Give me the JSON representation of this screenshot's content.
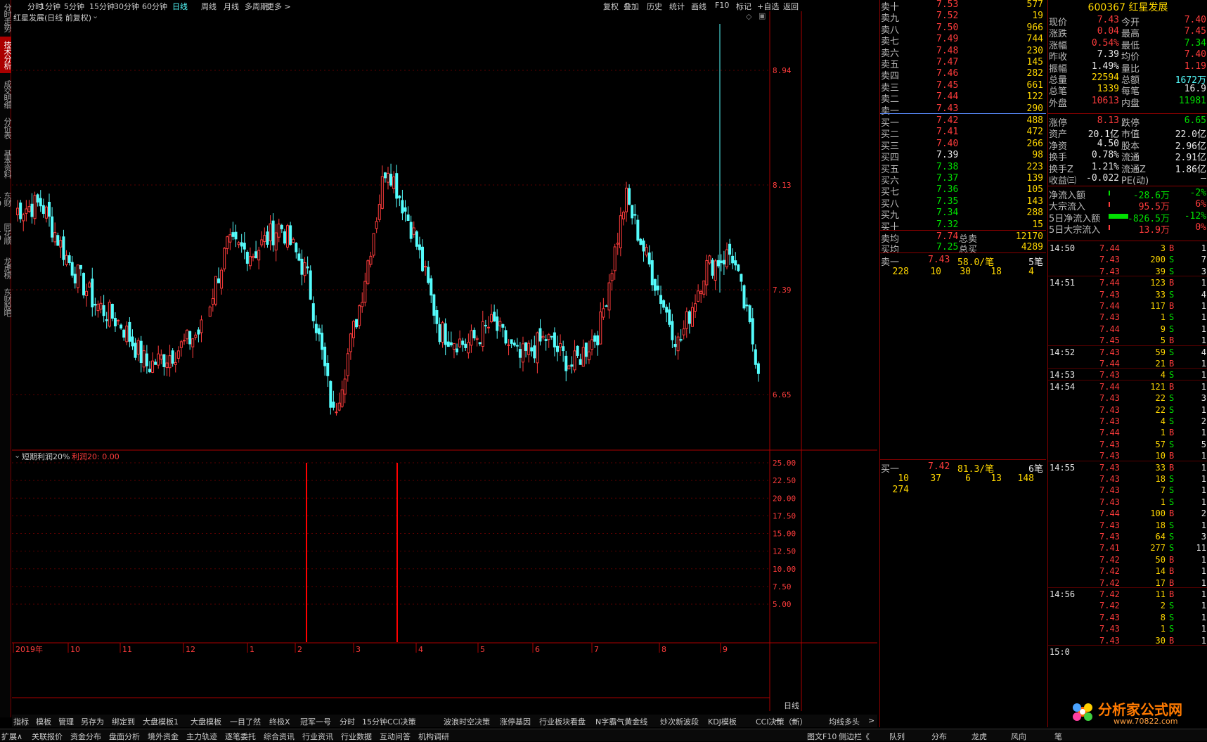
{
  "left_tabs": [
    "分时走势",
    "技术分析",
    "成交明细",
    "分价表",
    "基本资料",
    "东财10",
    "同花顺10",
    "龙虎榜",
    "东财股吧"
  ],
  "top_toolbar": {
    "periods": [
      "分时",
      "1分钟",
      "5分钟",
      "15分钟",
      "30分钟",
      "60分钟",
      "日线",
      "周线",
      "月线",
      "多周期",
      "更多 >"
    ],
    "active": "日线",
    "tools": [
      "复权",
      "叠加",
      "历史",
      "统计",
      "画线",
      "F10",
      "标记",
      "+自选",
      "返回"
    ]
  },
  "chart": {
    "title": "红星发展(日线 前复权)",
    "price_ticks": [
      "8.94",
      "8.13",
      "7.39",
      "6.65"
    ],
    "indicator_name": "短期利润20%",
    "indicator_value": "利润20: 0.00",
    "indicator_ticks": [
      "25.00",
      "22.50",
      "20.00",
      "17.50",
      "15.00",
      "12.50",
      "10.00",
      "7.50",
      "5.00"
    ],
    "date_labels": [
      "2019年",
      "10",
      "11",
      "12",
      "1",
      "2",
      "3",
      "4",
      "5",
      "6",
      "7",
      "8",
      "9"
    ],
    "period_label": "日线",
    "colors": {
      "up": "#ff3c3c",
      "down": "#54fcfc",
      "signal": "#ff0000"
    }
  },
  "chart_data": {
    "type": "candlestick",
    "title": "红星发展(日线 前复权)",
    "y_ticks": [
      8.94,
      8.13,
      7.39,
      6.65
    ],
    "x_labels": [
      "2019年",
      "10",
      "11",
      "12",
      "1",
      "2",
      "3",
      "4",
      "5",
      "6",
      "7",
      "8",
      "9"
    ],
    "indicator": {
      "name": "短期利润20%",
      "ticks": [
        25,
        22.5,
        20,
        17.5,
        15,
        12.5,
        10,
        7.5,
        5
      ],
      "signals": [
        {
          "month": "2",
          "value": 25
        },
        {
          "month": "3",
          "value": 25
        }
      ]
    },
    "approx_close_path": [
      7.95,
      8.0,
      7.6,
      7.3,
      7.15,
      6.85,
      6.95,
      7.1,
      7.7,
      7.65,
      7.85,
      7.5,
      6.5,
      7.3,
      8.3,
      7.8,
      7.1,
      7.0,
      7.15,
      6.9,
      7.05,
      6.85,
      7.1,
      8.05,
      7.5,
      7.0,
      7.55,
      7.65,
      6.85
    ]
  },
  "bottom_tabs": [
    "指标",
    "模板",
    "管理",
    "另存为",
    "绑定到",
    "大盘模板1",
    "大盘模板",
    "一目了然",
    "终极X",
    "冠军一号",
    "分时",
    "15分钟CCI决策",
    "波浪时空决策",
    "涨停基因",
    "行业板块看盘",
    "N字霸气黄金线",
    "炒次新波段",
    "KDJ模板",
    "CCI决策（新）",
    "均线多头",
    ">"
  ],
  "status_bar": {
    "items": [
      "扩展∧",
      "关联报价",
      "资金分布",
      "盘面分析",
      "境外资金",
      "主力轨迹",
      "逐笔委托",
      "综合资讯",
      "行业资讯",
      "行业数据",
      "互动问答",
      "机构调研"
    ],
    "right_items": [
      "图文F10",
      "侧边栏《",
      "队列",
      "分布",
      "龙虎",
      "风向",
      "笔"
    ]
  },
  "order_book": {
    "asks": [
      [
        "卖十",
        "7.53",
        "577"
      ],
      [
        "卖九",
        "7.52",
        "19"
      ],
      [
        "卖八",
        "7.50",
        "966"
      ],
      [
        "卖七",
        "7.49",
        "744"
      ],
      [
        "卖六",
        "7.48",
        "230"
      ],
      [
        "卖五",
        "7.47",
        "145"
      ],
      [
        "卖四",
        "7.46",
        "282"
      ],
      [
        "卖三",
        "7.45",
        "661"
      ],
      [
        "卖二",
        "7.44",
        "122"
      ],
      [
        "卖一",
        "7.43",
        "290"
      ]
    ],
    "bids": [
      [
        "买一",
        "7.42",
        "488"
      ],
      [
        "买二",
        "7.41",
        "472"
      ],
      [
        "买三",
        "7.40",
        "266"
      ],
      [
        "买四",
        "7.39",
        "98"
      ],
      [
        "买五",
        "7.38",
        "223"
      ],
      [
        "买六",
        "7.37",
        "139"
      ],
      [
        "买七",
        "7.36",
        "105"
      ],
      [
        "买八",
        "7.35",
        "143"
      ],
      [
        "买九",
        "7.34",
        "288"
      ],
      [
        "买十",
        "7.32",
        "15"
      ]
    ],
    "avg": [
      [
        "卖均",
        "7.74",
        "总卖",
        "12170"
      ],
      [
        "买均",
        "7.25",
        "总买",
        "4289"
      ]
    ],
    "ask_queue": {
      "label": "卖一",
      "price": "7.43",
      "avg": "58.0/笔",
      "count": "5笔",
      "orders": [
        "228",
        "10",
        "30",
        "18",
        "4"
      ]
    },
    "bid_queue": {
      "label": "买一",
      "price": "7.42",
      "avg": "81.3/笔",
      "count": "6笔",
      "orders": [
        "10",
        "37",
        "6",
        "13",
        "148",
        "274"
      ]
    }
  },
  "quote": {
    "code_name": "600367 红星发展",
    "rows": [
      [
        "现价",
        "7.43",
        "今开",
        "7.40"
      ],
      [
        "涨跌",
        "0.04",
        "最高",
        "7.45"
      ],
      [
        "涨幅",
        "0.54%",
        "最低",
        "7.34"
      ],
      [
        "昨收",
        "7.39",
        "均价",
        "7.40"
      ],
      [
        "振幅",
        "1.49%",
        "量比",
        "1.19"
      ],
      [
        "总量",
        "22594",
        "总额",
        "1672万"
      ],
      [
        "总笔",
        "1339",
        "每笔",
        "16.9"
      ],
      [
        "外盘",
        "10613",
        "内盘",
        "11981"
      ]
    ],
    "rows2": [
      [
        "涨停",
        "8.13",
        "跌停",
        "6.65"
      ],
      [
        "资产",
        "20.1亿",
        "市值",
        "22.0亿"
      ],
      [
        "净资",
        "4.50",
        "股本",
        "2.96亿"
      ],
      [
        "换手",
        "0.78%",
        "流通",
        "2.91亿"
      ],
      [
        "换手Z",
        "1.21%",
        "流通Z",
        "1.86亿"
      ],
      [
        "收益㈢",
        "-0.022",
        "PE(动)",
        "–"
      ]
    ],
    "flows": [
      [
        "净流入额",
        "-28.6万",
        "-2%"
      ],
      [
        "大宗流入",
        "95.5万",
        "6%"
      ],
      [
        "5日净流入额",
        "-826.5万",
        "-12%"
      ],
      [
        "5日大宗流入",
        "13.9万",
        "0%"
      ]
    ]
  },
  "trades": [
    [
      "14:50",
      "7.44",
      "3",
      "B",
      "1"
    ],
    [
      "",
      "7.43",
      "200",
      "S",
      "7"
    ],
    [
      "",
      "7.43",
      "39",
      "S",
      "3"
    ],
    [
      "14:51",
      "7.44",
      "123",
      "B",
      "1"
    ],
    [
      "",
      "7.43",
      "33",
      "S",
      "4"
    ],
    [
      "",
      "7.44",
      "117",
      "B",
      "1"
    ],
    [
      "",
      "7.43",
      "1",
      "S",
      "1"
    ],
    [
      "",
      "7.44",
      "9",
      "S",
      "1"
    ],
    [
      "",
      "7.45",
      "5",
      "B",
      "1"
    ],
    [
      "14:52",
      "7.43",
      "59",
      "S",
      "4"
    ],
    [
      "",
      "7.44",
      "21",
      "B",
      "1"
    ],
    [
      "14:53",
      "7.43",
      "4",
      "S",
      "1"
    ],
    [
      "14:54",
      "7.44",
      "121",
      "B",
      "1"
    ],
    [
      "",
      "7.43",
      "22",
      "S",
      "3"
    ],
    [
      "",
      "7.43",
      "22",
      "S",
      "1"
    ],
    [
      "",
      "7.43",
      "4",
      "S",
      "2"
    ],
    [
      "",
      "7.44",
      "1",
      "B",
      "1"
    ],
    [
      "",
      "7.43",
      "57",
      "S",
      "5"
    ],
    [
      "",
      "7.43",
      "10",
      "B",
      "1"
    ],
    [
      "14:55",
      "7.43",
      "33",
      "B",
      "1"
    ],
    [
      "",
      "7.43",
      "18",
      "S",
      "1"
    ],
    [
      "",
      "7.43",
      "7",
      "S",
      "1"
    ],
    [
      "",
      "7.43",
      "1",
      "S",
      "1"
    ],
    [
      "",
      "7.44",
      "100",
      "B",
      "2"
    ],
    [
      "",
      "7.43",
      "18",
      "S",
      "1"
    ],
    [
      "",
      "7.43",
      "64",
      "S",
      "3"
    ],
    [
      "",
      "7.41",
      "277",
      "S",
      "11"
    ],
    [
      "",
      "7.42",
      "50",
      "B",
      "1"
    ],
    [
      "",
      "7.42",
      "14",
      "B",
      "1"
    ],
    [
      "",
      "7.42",
      "17",
      "B",
      "1"
    ],
    [
      "14:56",
      "7.42",
      "11",
      "B",
      "1"
    ],
    [
      "",
      "7.42",
      "2",
      "S",
      "1"
    ],
    [
      "",
      "7.43",
      "8",
      "S",
      "1"
    ],
    [
      "",
      "7.43",
      "1",
      "S",
      "1"
    ],
    [
      "",
      "7.43",
      "30",
      "B",
      "1"
    ],
    [
      "15:0",
      "",
      "",
      "",
      ""
    ]
  ],
  "logo": {
    "text": "分析家公式网",
    "url": "www.70822.com"
  }
}
